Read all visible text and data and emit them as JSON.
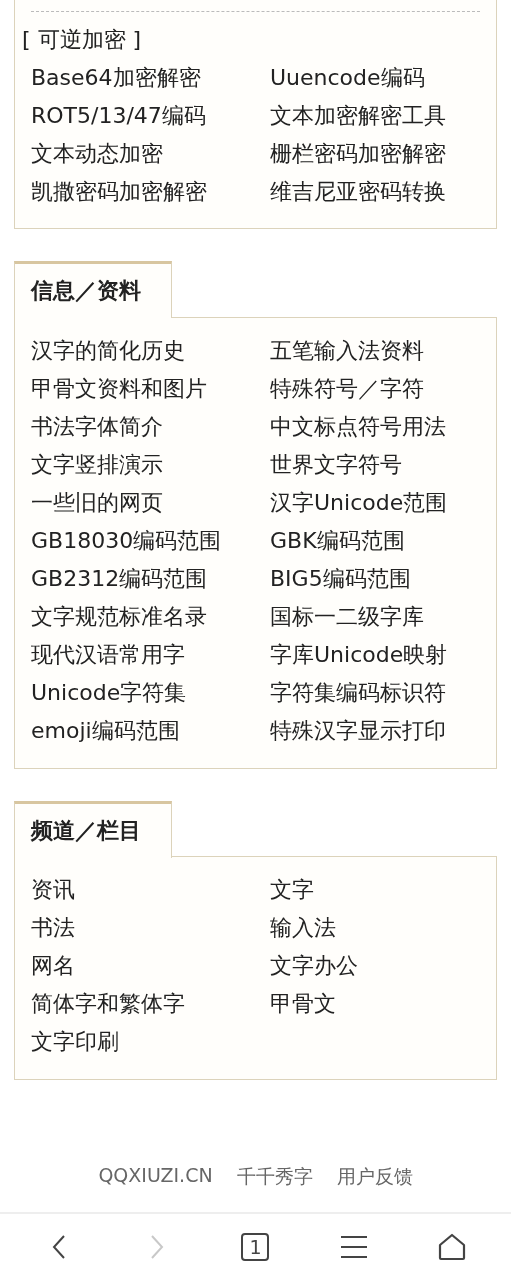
{
  "encryption_panel": {
    "heading": "[ 可逆加密 ]",
    "items": [
      "Base64加密解密",
      "Uuencode编码",
      "ROT5/13/47编码",
      "文本加密解密工具",
      "文本动态加密",
      "栅栏密码加密解密",
      "凯撒密码加密解密",
      "维吉尼亚密码转换"
    ]
  },
  "sections": [
    {
      "title": "信息／资料",
      "items": [
        "汉字的简化历史",
        "五笔输入法资料",
        "甲骨文资料和图片",
        "特殊符号／字符",
        "书法字体简介",
        "中文标点符号用法",
        "文字竖排演示",
        "世界文字符号",
        "一些旧的网页",
        "汉字Unicode范围",
        "GB18030编码范围",
        "GBK编码范围",
        "GB2312编码范围",
        "BIG5编码范围",
        "文字规范标准名录",
        "国标一二级字库",
        "现代汉语常用字",
        "字库Unicode映射",
        "Unicode字符集",
        "字符集编码标识符",
        "emoji编码范围",
        "特殊汉字显示打印"
      ]
    },
    {
      "title": "频道／栏目",
      "items": [
        "资讯",
        "文字",
        "书法",
        "输入法",
        "网名",
        "文字办公",
        "简体字和繁体字",
        "甲骨文",
        "文字印刷"
      ]
    }
  ],
  "footer": {
    "links": [
      "QQXIUZI.CN",
      "千千秀字",
      "用户反馈"
    ]
  },
  "nav_bar": {
    "buttons": [
      {
        "kind": "back",
        "disabled": false
      },
      {
        "kind": "forward",
        "disabled": true
      },
      {
        "kind": "tabs",
        "disabled": false,
        "count": "1"
      },
      {
        "kind": "menu",
        "disabled": false
      },
      {
        "kind": "home",
        "disabled": false
      }
    ]
  }
}
